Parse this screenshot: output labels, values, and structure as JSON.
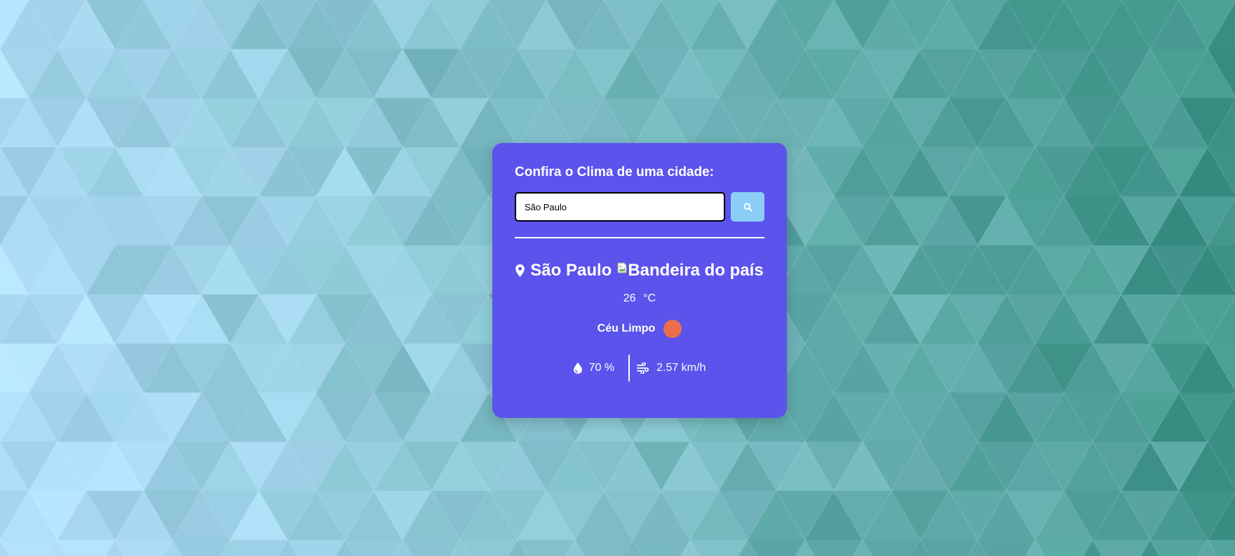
{
  "colors": {
    "card": "#5b53ec",
    "search_button": "#8ccdf8",
    "weather_icon": "#eb6f4a",
    "text": "#ffffff"
  },
  "header": {
    "title": "Confira o Clima de uma cidade:"
  },
  "search": {
    "value": "São Paulo",
    "button_icon": "search-icon"
  },
  "weather": {
    "city_icon": "map-pin-icon",
    "city": "São Paulo",
    "flag_alt": "Bandeira do país",
    "temperature": "26",
    "unit": "°C",
    "description": "Céu Limpo",
    "weather_icon": "clear-sky-sun-icon",
    "humidity_icon": "droplet-icon",
    "humidity": "70 %",
    "wind_icon": "wind-icon",
    "wind": "2.57 km/h"
  }
}
